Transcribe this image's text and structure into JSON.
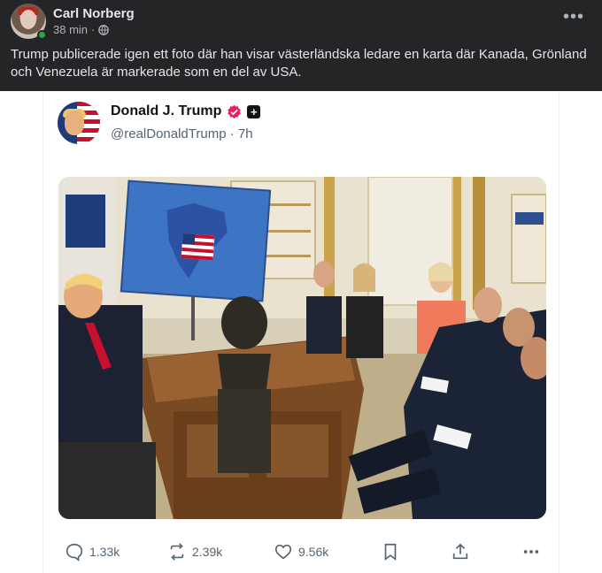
{
  "post": {
    "author": "Carl Norberg",
    "time": "38 min",
    "separator": "·",
    "privacy_icon": "globe-icon",
    "more_icon": "more-dots-icon",
    "more_label": "•••",
    "text": "Trump publicerade igen ett foto där han visar västerländska ledare en karta där Kanada, Grönland och Venezuela är markerade som en del av USA."
  },
  "embedded_post": {
    "display_name": "Donald J. Trump",
    "handle": "@realDonaldTrump",
    "time_sep": "·",
    "time": "7h",
    "verified_color": "#e0245e",
    "image_icon": "oval-office-photo",
    "actions": {
      "replies": "1.33k",
      "reposts": "2.39k",
      "likes": "9.56k"
    }
  },
  "colors": {
    "facebook_dark": "#242526",
    "text_muted": "#536471",
    "map_blue": "#3d74c4"
  }
}
